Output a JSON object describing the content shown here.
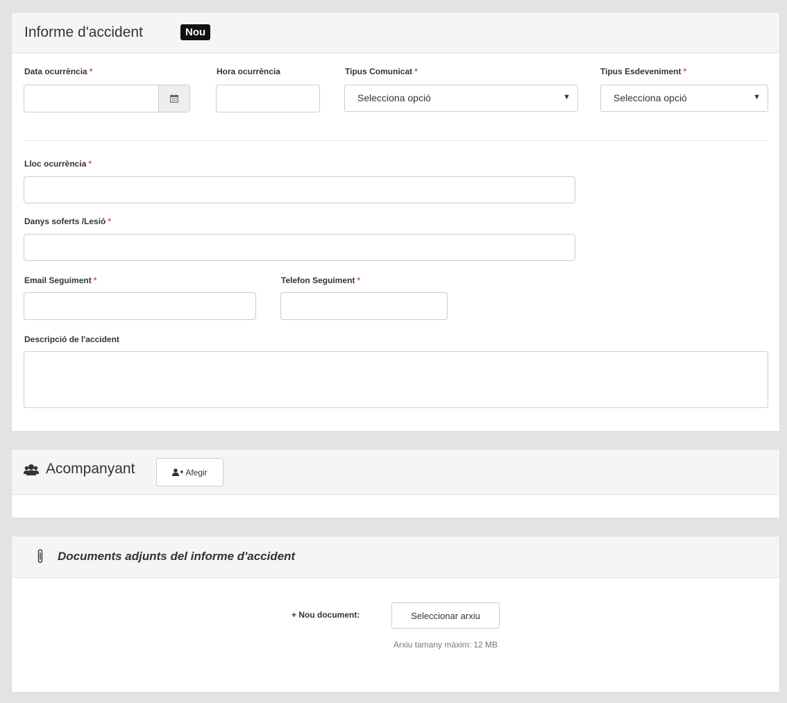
{
  "report": {
    "title": "Informe d'accident",
    "badge": "Nou",
    "required_mark": "*",
    "fields": {
      "date": {
        "label": "Data ocurrència",
        "value": ""
      },
      "time": {
        "label": "Hora ocurrència",
        "value": ""
      },
      "communication_type": {
        "label": "Tipus Comunicat",
        "selected": "Selecciona opció"
      },
      "event_type": {
        "label": "Tipus Esdeveniment",
        "selected": "Selecciona opció"
      },
      "place": {
        "label": "Lloc ocurrència",
        "value": ""
      },
      "damage": {
        "label": "Danys soferts /Lesió",
        "value": ""
      },
      "email": {
        "label": "Email Seguiment",
        "value": ""
      },
      "phone": {
        "label": "Telefon Seguiment",
        "value": ""
      },
      "description": {
        "label": "Descripció de l'accident",
        "value": ""
      }
    }
  },
  "companion": {
    "title": "Acompanyant",
    "add_label": "Afegir",
    "icons": {
      "title": "users-icon",
      "add": "user-plus-icon"
    }
  },
  "documents": {
    "title": "Documents adjunts del informe d'accident",
    "icon": "paperclip-icon",
    "new_label": "+ Nou document:",
    "select_label": "Seleccionar arxiu",
    "max_size_note": "Arxiu tamany màxim: 12 MB"
  },
  "colors": {
    "background": "#e3e3e3",
    "required": "#d9534f",
    "badge_bg": "#111111",
    "badge_text": "#ffffff"
  }
}
